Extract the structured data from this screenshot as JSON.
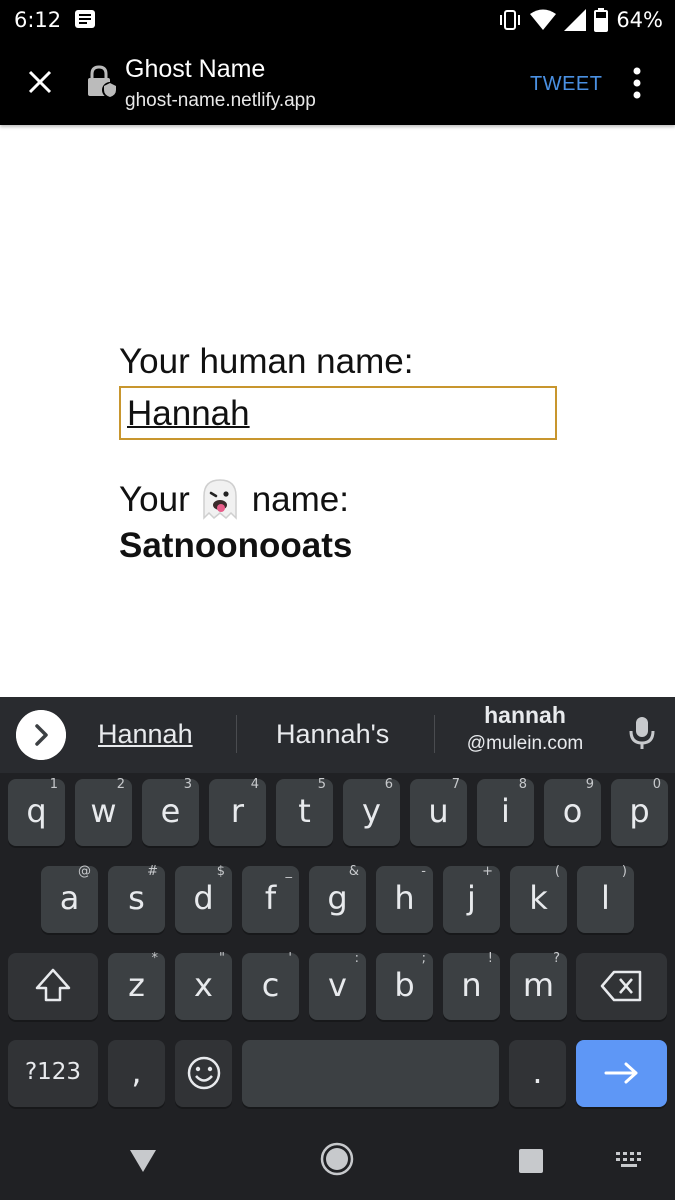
{
  "status_bar": {
    "time": "6:12",
    "battery": "64%"
  },
  "toolbar": {
    "title": "Ghost Name",
    "url": "ghost-name.netlify.app",
    "tweet_label": "TWEET"
  },
  "page": {
    "human_label": "Your human name:",
    "human_value": "Hannah",
    "ghost_label_before": "Your",
    "ghost_label_after": "name:",
    "ghost_result": "Satnoonooats"
  },
  "keyboard": {
    "suggestions": [
      "Hannah",
      "Hannah's"
    ],
    "email_suggestion": {
      "name": "hannah",
      "domain": "@mulein.com"
    },
    "row1": [
      {
        "key": "q",
        "hint": "1"
      },
      {
        "key": "w",
        "hint": "2"
      },
      {
        "key": "e",
        "hint": "3"
      },
      {
        "key": "r",
        "hint": "4"
      },
      {
        "key": "t",
        "hint": "5"
      },
      {
        "key": "y",
        "hint": "6"
      },
      {
        "key": "u",
        "hint": "7"
      },
      {
        "key": "i",
        "hint": "8"
      },
      {
        "key": "o",
        "hint": "9"
      },
      {
        "key": "p",
        "hint": "0"
      }
    ],
    "row2": [
      {
        "key": "a",
        "hint": "@"
      },
      {
        "key": "s",
        "hint": "#"
      },
      {
        "key": "d",
        "hint": "$"
      },
      {
        "key": "f",
        "hint": "_"
      },
      {
        "key": "g",
        "hint": "&"
      },
      {
        "key": "h",
        "hint": "-"
      },
      {
        "key": "j",
        "hint": "+"
      },
      {
        "key": "k",
        "hint": "("
      },
      {
        "key": "l",
        "hint": ")"
      }
    ],
    "row3": [
      {
        "key": "z",
        "hint": "*"
      },
      {
        "key": "x",
        "hint": "\""
      },
      {
        "key": "c",
        "hint": "'"
      },
      {
        "key": "v",
        "hint": ":"
      },
      {
        "key": "b",
        "hint": ";"
      },
      {
        "key": "n",
        "hint": "!"
      },
      {
        "key": "m",
        "hint": "?"
      }
    ],
    "symbols_label": "?123",
    "comma_label": ",",
    "period_label": "."
  },
  "colors": {
    "accent": "#4a90e2",
    "input_border": "#c8962e",
    "enter_key": "#5e97f6"
  }
}
